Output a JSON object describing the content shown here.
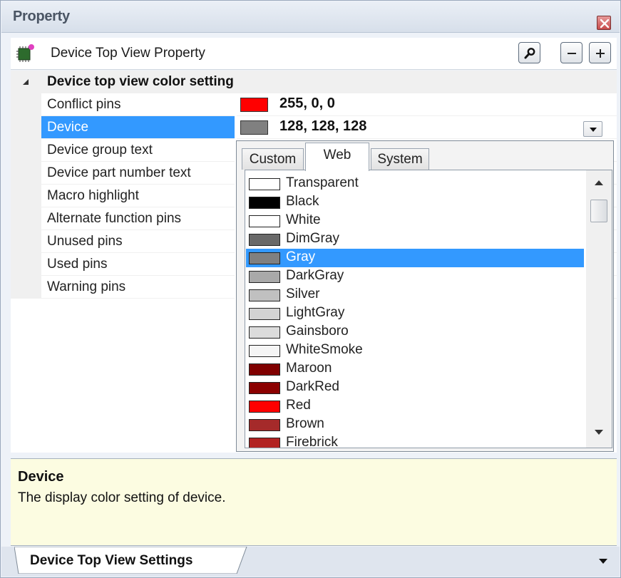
{
  "window": {
    "title": "Property"
  },
  "toolbar": {
    "title": "Device Top View Property",
    "icons": [
      "device-icon",
      "search-icon",
      "collapse-minus-icon",
      "expand-plus-icon"
    ]
  },
  "grid": {
    "category": "Device top view color setting",
    "rows": [
      {
        "name": "Conflict pins",
        "color": "#ff0000",
        "value": "255, 0, 0"
      },
      {
        "name": "Device",
        "color": "#808080",
        "value": "128, 128, 128",
        "selected": true
      },
      {
        "name": "Device group text"
      },
      {
        "name": "Device part number text"
      },
      {
        "name": "Macro highlight"
      },
      {
        "name": "Alternate function pins"
      },
      {
        "name": "Unused pins"
      },
      {
        "name": "Used pins"
      },
      {
        "name": "Warning pins"
      }
    ]
  },
  "picker": {
    "tabs": [
      "Custom",
      "Web",
      "System"
    ],
    "active_tab": "Web",
    "colors": [
      {
        "name": "Transparent",
        "hex": "#ffffff"
      },
      {
        "name": "Black",
        "hex": "#000000"
      },
      {
        "name": "White",
        "hex": "#ffffff"
      },
      {
        "name": "DimGray",
        "hex": "#696969"
      },
      {
        "name": "Gray",
        "hex": "#808080",
        "selected": true
      },
      {
        "name": "DarkGray",
        "hex": "#a9a9a9"
      },
      {
        "name": "Silver",
        "hex": "#c0c0c0"
      },
      {
        "name": "LightGray",
        "hex": "#d3d3d3"
      },
      {
        "name": "Gainsboro",
        "hex": "#dcdcdc"
      },
      {
        "name": "WhiteSmoke",
        "hex": "#f5f5f5"
      },
      {
        "name": "Maroon",
        "hex": "#800000"
      },
      {
        "name": "DarkRed",
        "hex": "#8b0000"
      },
      {
        "name": "Red",
        "hex": "#ff0000"
      },
      {
        "name": "Brown",
        "hex": "#a52a2a"
      },
      {
        "name": "Firebrick",
        "hex": "#b22222"
      }
    ]
  },
  "description": {
    "title": "Device",
    "text": "The display color setting of device."
  },
  "bottom_tab": {
    "label": "Device Top View Settings"
  },
  "colors": {
    "selection": "#3399ff",
    "description_bg": "#fcfce1"
  }
}
